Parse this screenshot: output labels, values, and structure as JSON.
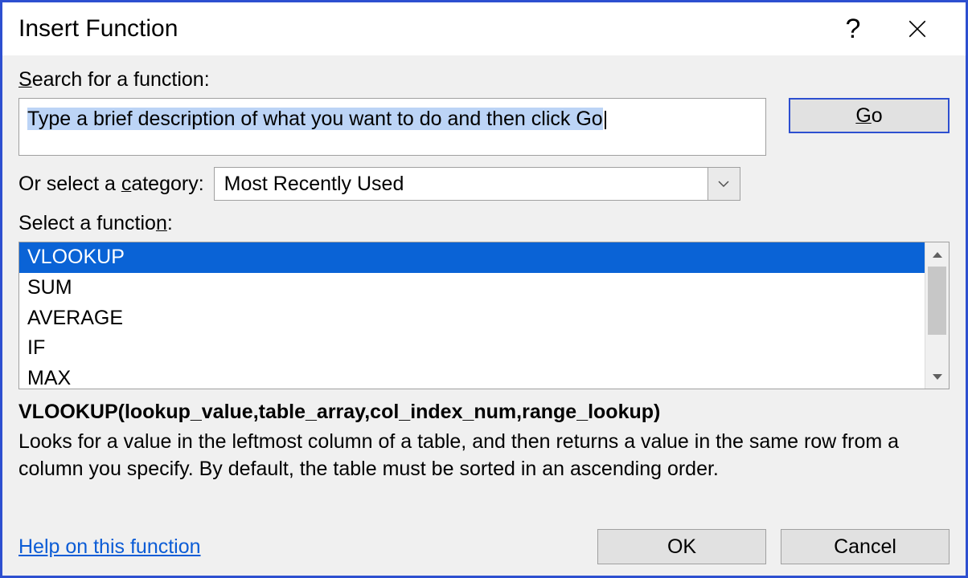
{
  "title": "Insert Function",
  "search": {
    "label_pre": "S",
    "label_rest": "earch for a function:",
    "value": "Type a brief description of what you want to do and then click Go",
    "go_pre": "G",
    "go_rest": "o"
  },
  "category": {
    "label_pre": "Or select a ",
    "label_under": "c",
    "label_rest": "ategory:",
    "selected": "Most Recently Used"
  },
  "funclist": {
    "label_pre": "Select a functio",
    "label_under": "n",
    "label_rest": ":",
    "items": [
      "VLOOKUP",
      "SUM",
      "AVERAGE",
      "IF",
      "MAX"
    ],
    "selected_index": 0
  },
  "detail": {
    "signature": "VLOOKUP(lookup_value,table_array,col_index_num,range_lookup)",
    "description": "Looks for a value in the leftmost column of a table, and then returns a value in the same row from a column you specify. By default, the table must be sorted in an ascending order."
  },
  "footer": {
    "help_link": "Help on this function",
    "ok": "OK",
    "cancel": "Cancel"
  }
}
